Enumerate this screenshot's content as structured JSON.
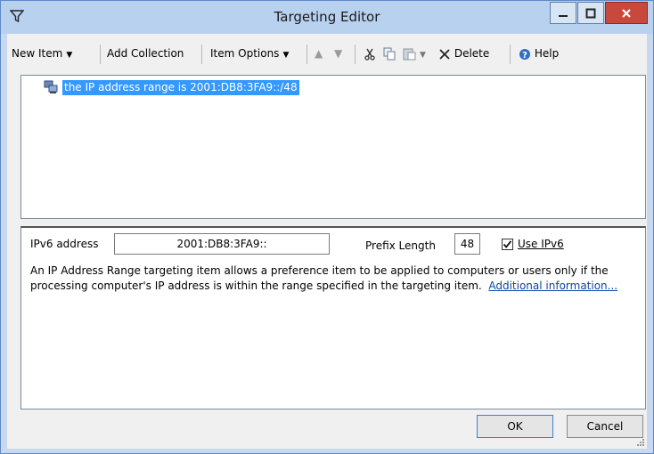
{
  "window": {
    "title": "Targeting Editor"
  },
  "toolbar": {
    "new_item": "New Item",
    "add_collection": "Add Collection",
    "item_options": "Item Options",
    "delete": "Delete",
    "help": "Help"
  },
  "tree": {
    "item_label": "the IP address range is 2001:DB8:3FA9::/48"
  },
  "props": {
    "ipv6_label": "IPv6 address",
    "ipv6_value": "2001:DB8:3FA9::",
    "prefix_label": "Prefix Length",
    "prefix_value": "48",
    "use_ipv6_label": "Use IPv6",
    "use_ipv6_checked": true,
    "description": "An IP Address Range targeting item allows a preference item to be applied to computers or users only if the processing computer's IP address is within the range specified in the targeting item.",
    "link_text": "Additional information..."
  },
  "buttons": {
    "ok": "OK",
    "cancel": "Cancel"
  }
}
